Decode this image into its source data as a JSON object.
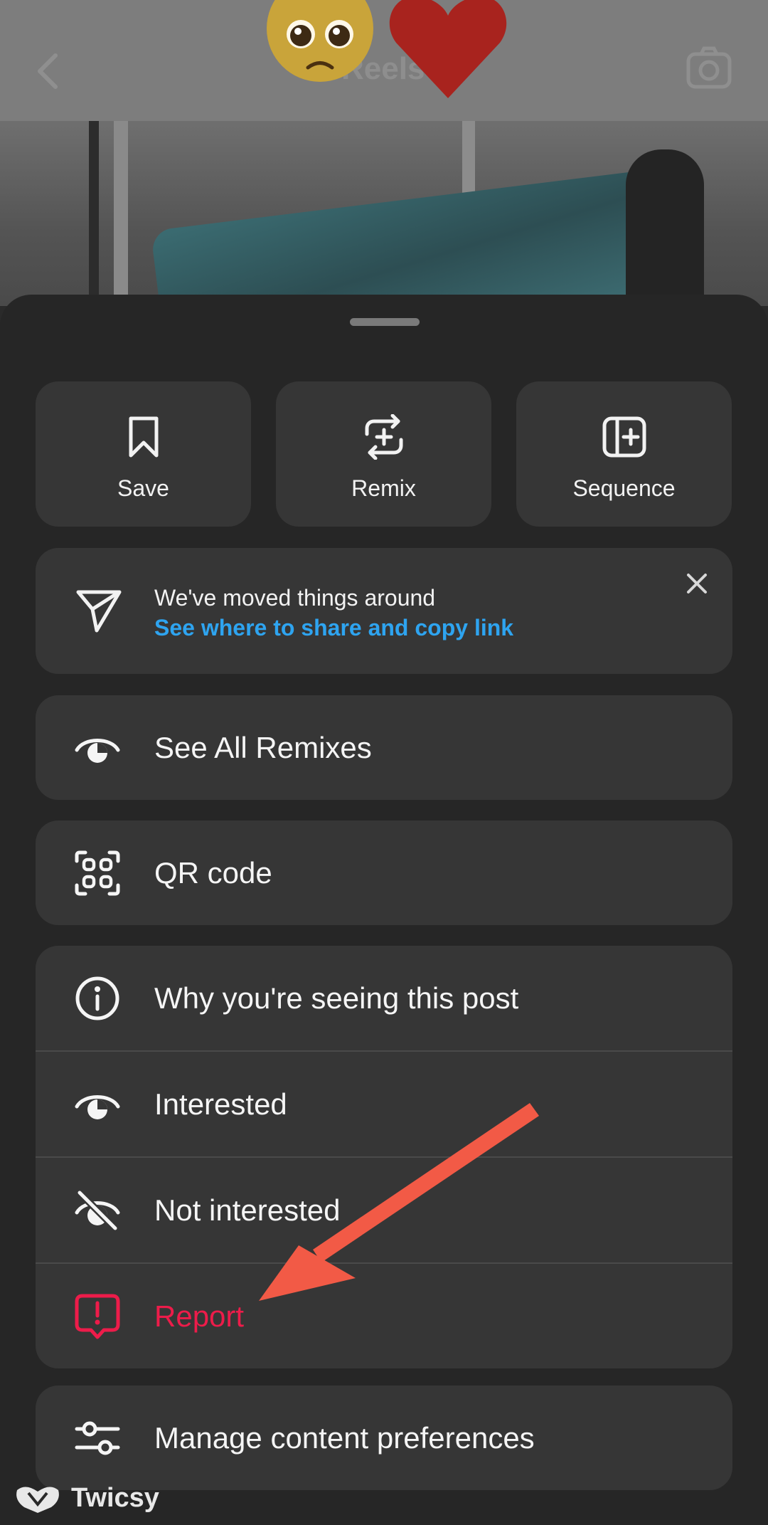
{
  "background": {
    "title": "Reels"
  },
  "actions": [
    {
      "label": "Save",
      "icon": "bookmark-icon"
    },
    {
      "label": "Remix",
      "icon": "remix-icon"
    },
    {
      "label": "Sequence",
      "icon": "sequence-icon"
    }
  ],
  "notice": {
    "line1": "We've moved things around",
    "link": "See where to share and copy link",
    "icon": "send-icon",
    "close_icon": "close-icon"
  },
  "menu": {
    "see_all_remixes": "See All Remixes",
    "qr_code": "QR code",
    "why_seeing": "Why you're seeing this post",
    "interested": "Interested",
    "not_interested": "Not interested",
    "report": "Report",
    "manage_prefs": "Manage content preferences"
  },
  "watermark": {
    "name": "Twicsy"
  },
  "colors": {
    "report": "#ed1c4a",
    "link": "#2ea4f0",
    "arrow": "#f25a46",
    "sheet": "#262626",
    "card": "#363636"
  }
}
